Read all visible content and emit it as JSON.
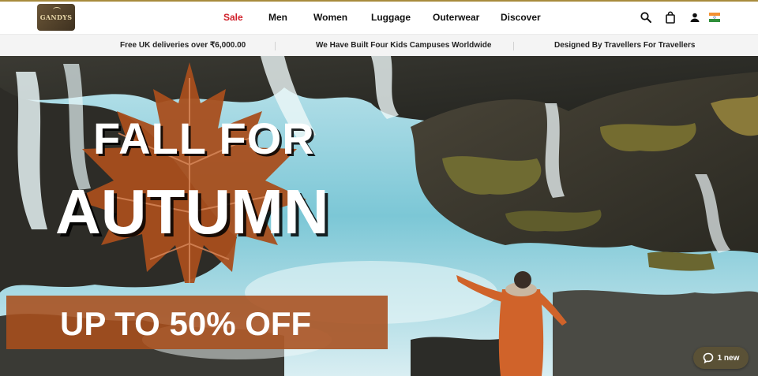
{
  "brand": {
    "logo_text": "GANDYS"
  },
  "nav": {
    "items": [
      {
        "label": "Sale",
        "highlight": true
      },
      {
        "label": "Men"
      },
      {
        "label": "Women"
      },
      {
        "label": "Luggage"
      },
      {
        "label": "Outerwear"
      },
      {
        "label": "Discover"
      }
    ],
    "sale_color": "#d0202a"
  },
  "tools": [
    "search-icon",
    "bag-icon",
    "account-icon",
    "india-flag-icon"
  ],
  "announcements": [
    "Free UK deliveries over ₹6,000.00",
    "We Have Built Four Kids Campuses Worldwide",
    "Designed By Travellers For Travellers"
  ],
  "hero": {
    "headline_line1": "FALL FOR",
    "headline_line2": "AUTUMN",
    "offer": "UP TO 50% OFF",
    "accent_color": "#a84e1c"
  },
  "chat": {
    "label": "1 new"
  }
}
